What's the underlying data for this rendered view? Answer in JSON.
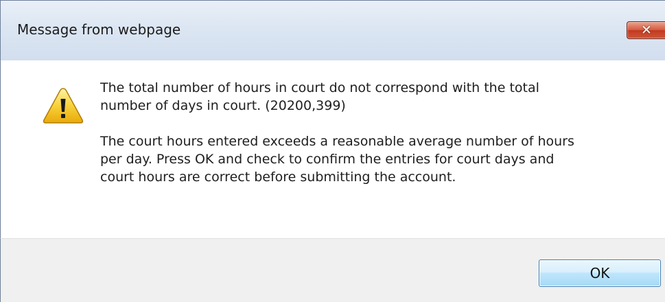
{
  "dialog": {
    "title": "Message from webpage",
    "close_icon": "close-icon",
    "icon": "warning-icon",
    "message_line_1": "The total number of hours in court do not correspond with the total\nnumber of days in court. (20200,399)",
    "message_line_2": "The court hours entered exceeds a reasonable average number of hours\nper day. Press OK and check to confirm the entries for court days and\ncourt hours are correct before submitting the account.",
    "ok_label": "OK"
  },
  "colors": {
    "title_bar": "#dce6f3",
    "close_button": "#c94a2e",
    "footer": "#f0f0f0",
    "ok_border": "#3c7fb1",
    "warning": "#f4c20d"
  }
}
